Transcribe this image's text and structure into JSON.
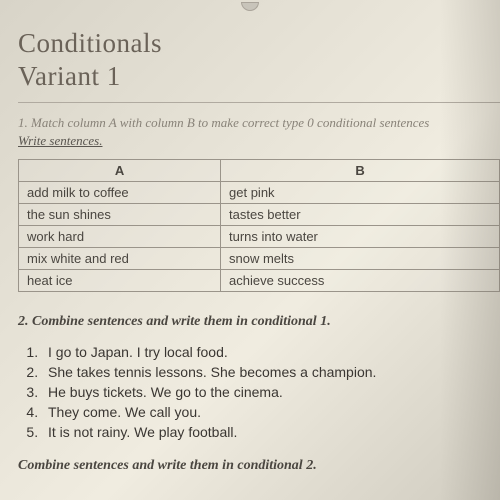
{
  "header": {
    "title": "Conditionals",
    "subtitle": "Variant 1"
  },
  "exercise1": {
    "instruction": "1. Match column A with column B to make correct type 0 conditional sentences",
    "write": "Write sentences.",
    "colA_header": "A",
    "colB_header": "B",
    "rows": [
      {
        "a": "add milk to coffee",
        "b": "get pink"
      },
      {
        "a": "the sun shines",
        "b": "tastes better"
      },
      {
        "a": "work hard",
        "b": "turns into water"
      },
      {
        "a": "mix white and red",
        "b": "snow melts"
      },
      {
        "a": "heat ice",
        "b": "achieve success"
      }
    ]
  },
  "exercise2": {
    "heading": "2. Combine sentences and write them in conditional 1.",
    "items": [
      "I go to Japan. I try local food.",
      "She takes tennis lessons. She becomes a champion.",
      "He buys tickets. We go to the cinema.",
      "They come. We call you.",
      "It is not rainy. We play football."
    ]
  },
  "exercise3": {
    "heading": "Combine sentences and write them in conditional 2."
  }
}
